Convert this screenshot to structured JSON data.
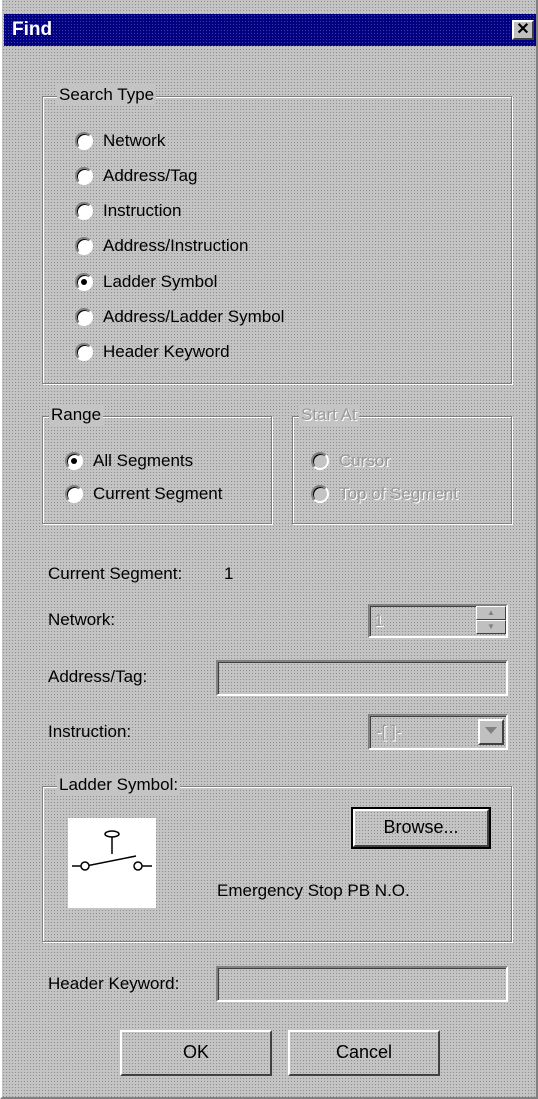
{
  "window": {
    "title": "Find",
    "close_glyph": "✕"
  },
  "search_type": {
    "legend": "Search Type",
    "options": [
      {
        "label": "Network",
        "checked": false
      },
      {
        "label": "Address/Tag",
        "checked": false
      },
      {
        "label": "Instruction",
        "checked": false
      },
      {
        "label": "Address/Instruction",
        "checked": false
      },
      {
        "label": "Ladder Symbol",
        "checked": true
      },
      {
        "label": "Address/Ladder Symbol",
        "checked": false
      },
      {
        "label": "Header Keyword",
        "checked": false
      }
    ]
  },
  "range": {
    "legend": "Range",
    "options": [
      {
        "label": "All Segments",
        "checked": true
      },
      {
        "label": "Current Segment",
        "checked": false
      }
    ]
  },
  "start_at": {
    "legend": "Start At",
    "options": [
      {
        "label": "Cursor",
        "checked": false
      },
      {
        "label": "Top of Segment",
        "checked": false
      }
    ]
  },
  "current_segment": {
    "label": "Current Segment:",
    "value": "1"
  },
  "network": {
    "label": "Network:",
    "value": "1"
  },
  "address_tag": {
    "label": "Address/Tag:",
    "value": ""
  },
  "instruction": {
    "label": "Instruction:",
    "value": "-[ ]-"
  },
  "ladder_symbol": {
    "legend": "Ladder Symbol:",
    "browse_label": "Browse...",
    "description": "Emergency Stop PB N.O.",
    "icon": "pushbutton-normally-open-icon"
  },
  "header_keyword": {
    "label": "Header Keyword:",
    "value": ""
  },
  "buttons": {
    "ok": "OK",
    "cancel": "Cancel"
  }
}
